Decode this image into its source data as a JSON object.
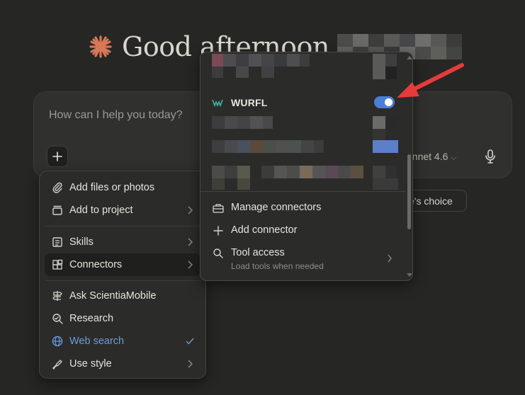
{
  "greeting": {
    "text": "Good afternoon",
    "icon": "claude-star-icon"
  },
  "composer": {
    "placeholder": "How can I help you today?",
    "model_label": "onnet 4.6",
    "add_icon": "plus-icon",
    "mic_icon": "microphone-icon"
  },
  "styles_pill": {
    "label": "e's choice"
  },
  "menu": {
    "items": [
      {
        "label": "Add files or photos",
        "icon": "paperclip-icon"
      },
      {
        "label": "Add to project",
        "icon": "project-box-icon",
        "chevron": true
      },
      {
        "label": "Skills",
        "icon": "skills-icon",
        "chevron": true
      },
      {
        "label": "Connectors",
        "icon": "connectors-icon",
        "chevron": true,
        "active": true
      },
      {
        "label": "Ask ScientiaMobile",
        "icon": "signpost-icon"
      },
      {
        "label": "Research",
        "icon": "research-icon"
      },
      {
        "label": "Web search",
        "icon": "globe-icon",
        "checked": true,
        "color": "#6c9be0"
      },
      {
        "label": "Use style",
        "icon": "pen-nib-icon",
        "chevron": true
      }
    ]
  },
  "connectors_popover": {
    "wurfl": {
      "label": "WURFL",
      "enabled": true,
      "toggle_color": "#4b7fd6"
    },
    "footer": [
      {
        "label": "Manage connectors",
        "icon": "toolbox-icon"
      },
      {
        "label": "Add connector",
        "icon": "plus-icon"
      },
      {
        "label": "Tool access",
        "sublabel": "Load tools when needed",
        "icon": "search-icon",
        "chevron": true
      }
    ]
  },
  "annotation": {
    "arrow_color": "#e63b3b"
  },
  "colors": {
    "background": "#262624",
    "accent": "#d97757"
  }
}
